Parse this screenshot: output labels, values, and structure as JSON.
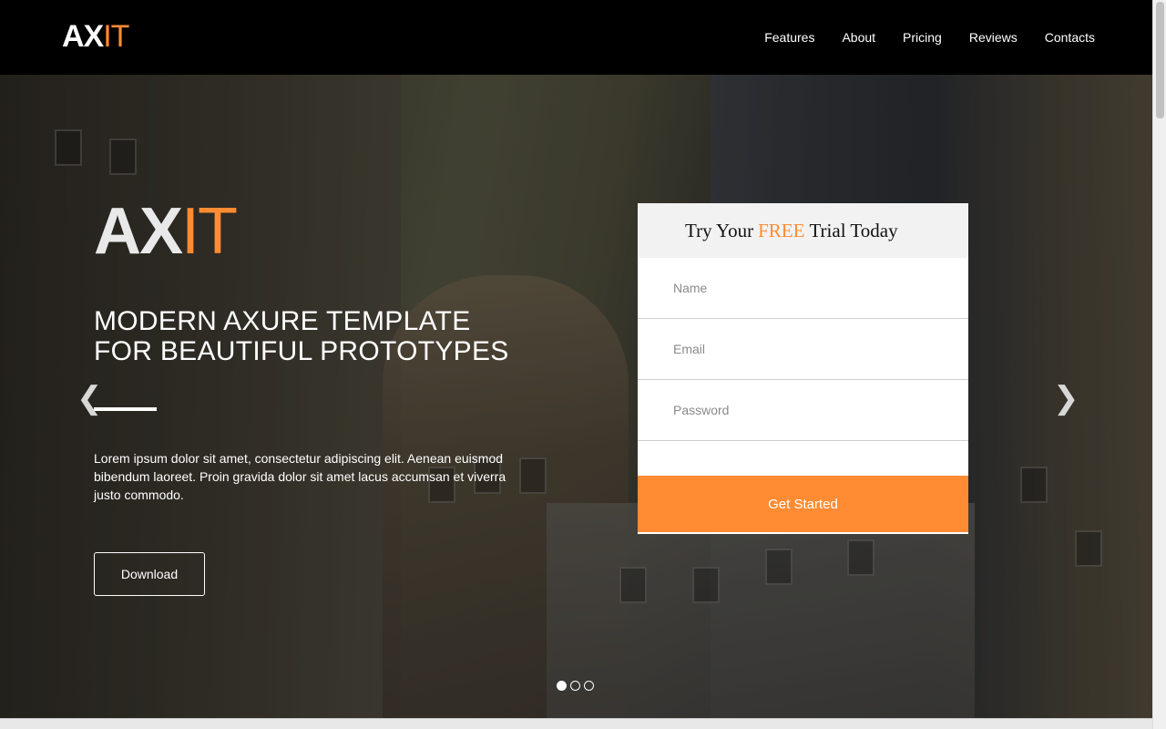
{
  "navbar": {
    "logo_ax": "AX",
    "logo_it": "IT",
    "links": [
      "Features",
      "About",
      "Pricing",
      "Reviews",
      "Contacts"
    ]
  },
  "hero": {
    "logo_ax": "AX",
    "logo_it": "IT",
    "headline_line1": "MODERN AXURE TEMPLATE",
    "headline_line2": "FOR BEAUTIFUL PROTOTYPES",
    "description": "Lorem ipsum dolor sit amet, consectetur adipiscing elit. Aenean euismod bibendum laoreet. Proin gravida dolor sit amet lacus accumsan et viverra justo commodo.",
    "download_label": "Download",
    "prev_icon": "chevron-left-icon",
    "next_icon": "chevron-right-icon"
  },
  "trial_form": {
    "title_prefix": "Try Your",
    "title_highlight": "FREE",
    "title_suffix": "Trial Today",
    "name_placeholder": "Name",
    "email_placeholder": "Email",
    "password_placeholder": "Password",
    "submit_label": "Get Started"
  },
  "slider": {
    "dots": 3,
    "active_index": 0
  },
  "colors": {
    "accent": "#ff8c33",
    "navbar_bg": "#000000",
    "form_header_bg": "#f2f2f2"
  }
}
